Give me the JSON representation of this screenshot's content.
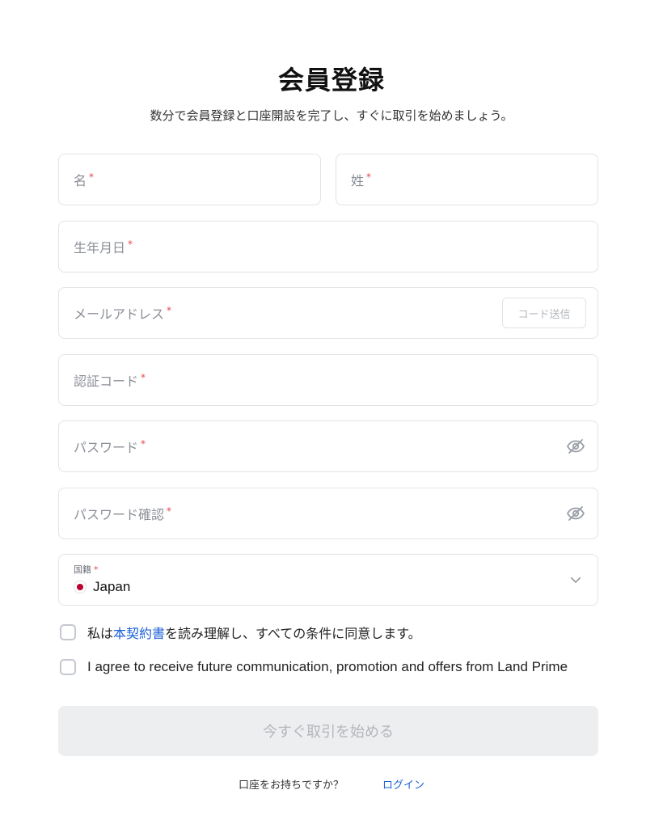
{
  "header": {
    "title": "会員登録",
    "subtitle": "数分で会員登録と口座開設を完了し、すぐに取引を始めましょう。"
  },
  "form": {
    "first_name": {
      "label": "名",
      "required": "*"
    },
    "last_name": {
      "label": "姓",
      "required": "*"
    },
    "birthdate": {
      "label": "生年月日",
      "required": "*"
    },
    "email": {
      "label": "メールアドレス",
      "required": "*",
      "send_code_label": "コード送信"
    },
    "verification_code": {
      "label": "認証コード",
      "required": "*"
    },
    "password": {
      "label": "パスワード",
      "required": "*"
    },
    "password_confirm": {
      "label": "パスワード確認",
      "required": "*"
    },
    "nationality": {
      "label": "国籍",
      "required": "*",
      "value": "Japan",
      "flag": "japan-flag-icon"
    }
  },
  "agreements": {
    "terms_prefix": "私は",
    "terms_link": "本契約書",
    "terms_suffix": "を読み理解し、すべての条件に同意します。",
    "marketing": "I agree to receive future communication, promotion and offers from Land Prime"
  },
  "actions": {
    "submit_label": "今すぐ取引を始める"
  },
  "footer": {
    "prompt": "口座をお持ちですか？",
    "login_label": "ログイン"
  },
  "colors": {
    "required": "#e5484d",
    "link": "#1a5fd6",
    "border": "#e1e3e7",
    "submit_disabled_bg": "#edeef0"
  }
}
